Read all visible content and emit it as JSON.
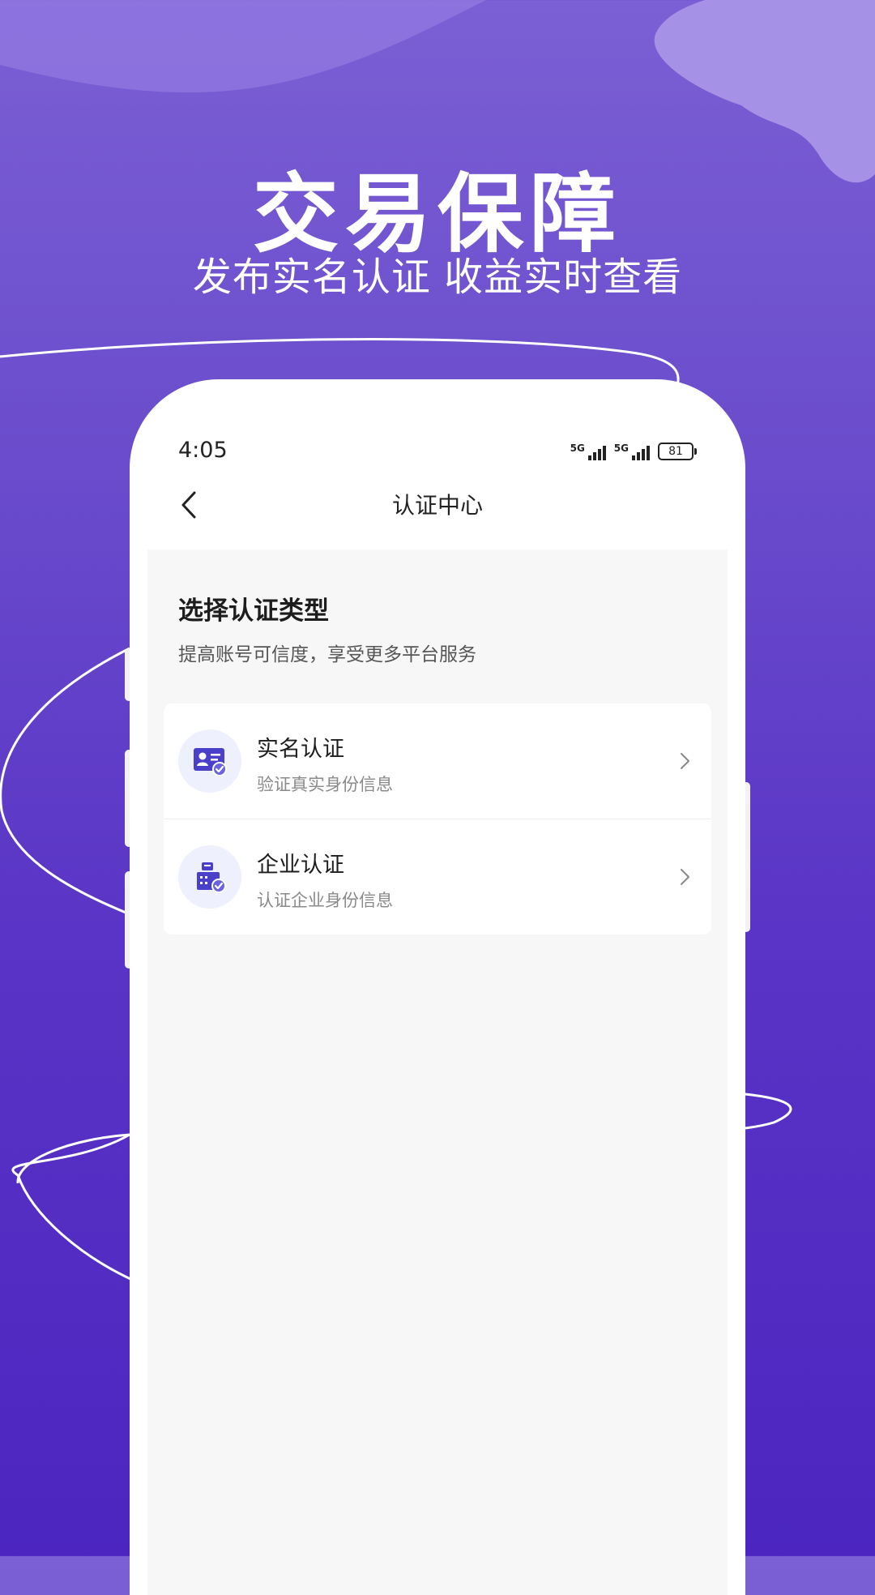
{
  "promo": {
    "title": "交易保障",
    "subtitle": "发布实名认证 收益实时查看"
  },
  "status_bar": {
    "time": "4:05",
    "network_1": "5G",
    "network_2": "5G",
    "battery": "81"
  },
  "nav": {
    "back_icon": "chevron-left-icon",
    "title": "认证中心"
  },
  "section": {
    "title": "选择认证类型",
    "subtitle": "提高账号可信度，享受更多平台服务"
  },
  "items": [
    {
      "title": "实名认证",
      "subtitle": "验证真实身份信息",
      "icon": "id-card-check-icon"
    },
    {
      "title": "企业认证",
      "subtitle": "认证企业身份信息",
      "icon": "building-check-icon"
    }
  ],
  "colors": {
    "background_top": "#7b5fd4",
    "background_bottom": "#4c25c0",
    "accent": "#4a3fc8",
    "icon_bg": "#eef1fd"
  }
}
